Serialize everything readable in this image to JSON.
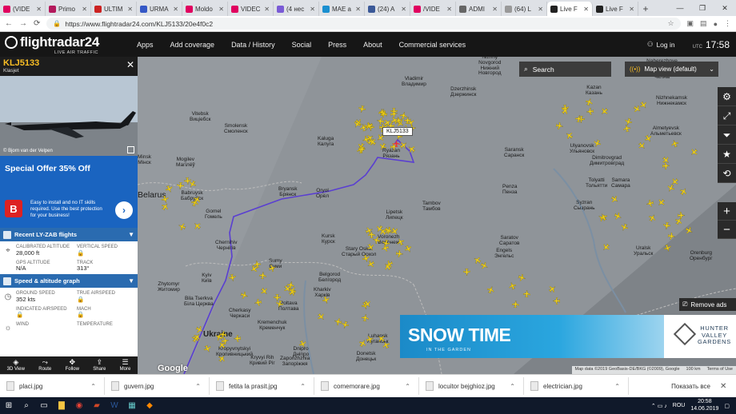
{
  "browser": {
    "tabs": [
      {
        "title": "(VIDE",
        "color": "#e0005f"
      },
      {
        "title": "Primo",
        "color": "#b3195c"
      },
      {
        "title": "ULTIM",
        "color": "#c22"
      },
      {
        "title": "URMA",
        "color": "#3558c6"
      },
      {
        "title": "Moldo",
        "color": "#e0005f"
      },
      {
        "title": "VIDEC",
        "color": "#e0005f"
      },
      {
        "title": "(4 нес",
        "color": "#7a5bd6"
      },
      {
        "title": "MAE a",
        "color": "#1a8fd0"
      },
      {
        "title": "(24) A",
        "color": "#3b5998"
      },
      {
        "title": "/VIDE",
        "color": "#e0005f"
      },
      {
        "title": "ADMI",
        "color": "#666"
      },
      {
        "title": "(64) L",
        "color": "#999"
      },
      {
        "title": "Live F",
        "color": "#222"
      },
      {
        "title": "Live F",
        "color": "#222"
      }
    ],
    "active_tab": 12,
    "new_tab": "+",
    "url": "https://www.flightradar24.com/KLJ5133/20e4f0c2"
  },
  "header": {
    "logo": "flightradar24",
    "logo_sub": "LIVE AIR TRAFFIC",
    "menu": [
      "Apps",
      "Add coverage",
      "Data / History",
      "Social",
      "Press",
      "About",
      "Commercial services"
    ],
    "login": "Log in",
    "utc_label": "UTC",
    "time": "17:58"
  },
  "panel": {
    "callsign": "KLJ5133",
    "airline": "Klasjet",
    "photo_credit": "© Bjorn van der Velpen",
    "ad": {
      "headline": "Special Offer 35% Off",
      "badge": "B",
      "text": "Easy to install and no IT skills required. Use the best protection for your business!"
    },
    "recent_section": "Recent LY-ZAB flights",
    "fields": [
      {
        "label": "CALIBRATED ALTITUDE",
        "value": "28,000 ft"
      },
      {
        "label": "VERTICAL SPEED",
        "value": "🔒"
      },
      {
        "label": "GPS ALTITUDE",
        "value": "N/A"
      },
      {
        "label": "TRACK",
        "value": "313°"
      }
    ],
    "speed_section": "Speed & altitude graph",
    "fields2": [
      {
        "label": "GROUND SPEED",
        "value": "352 kts"
      },
      {
        "label": "TRUE AIRSPEED",
        "value": "🔒"
      },
      {
        "label": "INDICATED AIRSPEED",
        "value": "🔒"
      },
      {
        "label": "MACH",
        "value": "🔒"
      },
      {
        "label": "WIND",
        "value": ""
      },
      {
        "label": "TEMPERATURE",
        "value": ""
      }
    ],
    "bottom": [
      "3D View",
      "Route",
      "Follow",
      "Share",
      "More"
    ]
  },
  "map": {
    "search_label": "Search",
    "map_view": "Map view (default)",
    "remove_ads": "Remove ads",
    "callsign_label": "KLJ5133",
    "banner": {
      "title": "SNOW TIME",
      "sub": "IN THE GARDEN",
      "brand": "HUNTER\nVALLEY\nGARDENS"
    },
    "attribution": [
      "Map data ©2019 GeoBasis-DE/BKG (©2009), Google",
      "100 km",
      "Terms of Use"
    ],
    "google": "Google",
    "cities": [
      {
        "name": "Nizhny\nNovgorod\nНижний\nНовгород"
      },
      {
        "name": "Vladimir\nВладимир"
      },
      {
        "name": "Dzerzhinsk\nДзержинск"
      },
      {
        "name": "Kazan\nКазань"
      },
      {
        "name": "Naberezhnye\nChelny\nНабережные\nЧелны"
      },
      {
        "name": "Nizhnekamsk\nНижнекамск"
      },
      {
        "name": "Almetyevsk\nАльметьевск"
      },
      {
        "name": "Vitebsk\nВиціебск"
      },
      {
        "name": "Smolensk\nСмоленск"
      },
      {
        "name": "Kaluga\nКалуга"
      },
      {
        "name": "Ryazan\nРязань"
      },
      {
        "name": "Saransk\nСаранск"
      },
      {
        "name": "Penza\nПенза"
      },
      {
        "name": "Ulyanovsk\nУльяновск"
      },
      {
        "name": "Dimitrovgrad\nДимитровград"
      },
      {
        "name": "Tolyatti\nТольятти"
      },
      {
        "name": "Samara\nСамара"
      },
      {
        "name": "Syzran\nСызрань"
      },
      {
        "name": "Minsk\nМінск"
      },
      {
        "name": "Mogilev\nМагілёў"
      },
      {
        "name": "Bryansk\nБрянск"
      },
      {
        "name": "Oryol\nОрёл"
      },
      {
        "name": "Tambov\nТамбов"
      },
      {
        "name": "Lipetsk\nЛипецк"
      },
      {
        "name": "Babruysk\nБабруйск"
      },
      {
        "name": "Gomel\nГомель"
      },
      {
        "name": "Kursk\nКурск"
      },
      {
        "name": "Voronezh\nВоронеж"
      },
      {
        "name": "Stary Oskol\nСтарый Оскол"
      },
      {
        "name": "Saratov\nСаратов"
      },
      {
        "name": "Engels\nЭнгельс"
      },
      {
        "name": "Sumy\nСуми"
      },
      {
        "name": "Belgorod\nБелгород"
      },
      {
        "name": "Chernihiv\nЧернігів"
      },
      {
        "name": "Kyiv\nКиїв"
      },
      {
        "name": "Zhytomyr\nЖитомир"
      },
      {
        "name": "Bila Tserkva\nБіла Церква"
      },
      {
        "name": "Cherkasy\nЧеркаси"
      },
      {
        "name": "Kharkiv\nХарків"
      },
      {
        "name": "Poltava\nПолтава"
      },
      {
        "name": "Kremenchuk\nКременчук"
      },
      {
        "name": "Kropyvnytskyi\nКропивницький"
      },
      {
        "name": "Dnipro\nДніпро"
      },
      {
        "name": "Kryvyi Rih\nКривий Ріг"
      },
      {
        "name": "Zaporizhzhia\nЗапоріжжя"
      },
      {
        "name": "Donetsk\nДонецьк"
      },
      {
        "name": "Luhansk\nЛуганськ"
      },
      {
        "name": "Uralsk\nУральск"
      },
      {
        "name": "Orenburg\nОренбург"
      }
    ],
    "countries": [
      "Belarus",
      "Ukraine"
    ]
  },
  "downloads": {
    "items": [
      "placi.jpg",
      "guvern.jpg",
      "fetita la prasit.jpg",
      "comemorare.jpg",
      "locuitor bejghioz.jpg",
      "electrician.jpg"
    ],
    "show_all": "Показать все"
  },
  "taskbar": {
    "lang": "ROU",
    "time": "20:58",
    "date": "14.06.2019"
  },
  "colors": {
    "plane": "#f2d21c",
    "track": "#5a3fd1",
    "ad_blue": "#1a64c0",
    "section_blue": "#2a6bb0"
  }
}
